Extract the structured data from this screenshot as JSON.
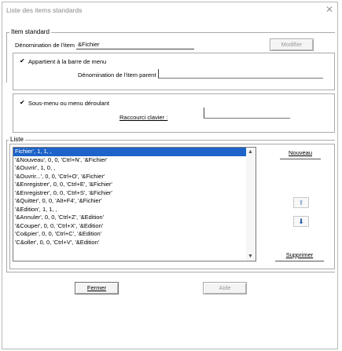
{
  "window": {
    "title": "Liste des items standards",
    "close_glyph": "✕"
  },
  "item_group": {
    "legend": "Item standard",
    "name_label": "Dénomination de l'item :",
    "name_value": "&Fichier",
    "modify_button": "Modifier"
  },
  "menubar_group": {
    "checkbox_label": "Appartient à la barre de menu",
    "checked_glyph": "✔",
    "parent_label": "Dénomination de l'item parent :",
    "parent_value": ""
  },
  "submenu_group": {
    "checkbox_label": "Sous-menu ou menu déroulant",
    "checked_glyph": "✔",
    "shortcut_label": "Raccourci clavier :",
    "shortcut_value": ""
  },
  "list_group": {
    "legend": "Liste",
    "items": [
      "Fichier', 1, 1, ,",
      "'&Nouveau', 0, 0, 'Ctrl+N', '&Fichier'",
      "'&Ouvrir', 1, 0, ,",
      "'&Ouvrir...', 0, 0, 'Ctrl+O', '&Fichier'",
      "'&Enregistrer', 0, 0, 'Ctrl+E', '&Fichier'",
      "'&Enregistrer', 0, 0, 'Ctrl+S', '&Fichier'",
      "'&Quitter', 0, 0, 'Alt+F4', '&Fichier'",
      "'&Edition', 1, 1, ,",
      "'&Annuler', 0, 0, 'Ctrl+Z', '&Edition'",
      "'&Couper', 0, 0, 'Ctrl+X', '&Edition'",
      "'Co&pier', 0, 0, 'Ctrl+C', '&Edition'",
      "'C&oller', 0, 0, 'Ctrl+V', '&Edition'"
    ],
    "selected_index": 0,
    "scroll_up": "▲",
    "scroll_down": "▼",
    "new_button": "Nouveau",
    "move_up_glyph": "⬆",
    "move_down_glyph": "⬇",
    "delete_button": "Supprimer"
  },
  "footer": {
    "close_button": "Fermer",
    "help_button": "Aide"
  }
}
